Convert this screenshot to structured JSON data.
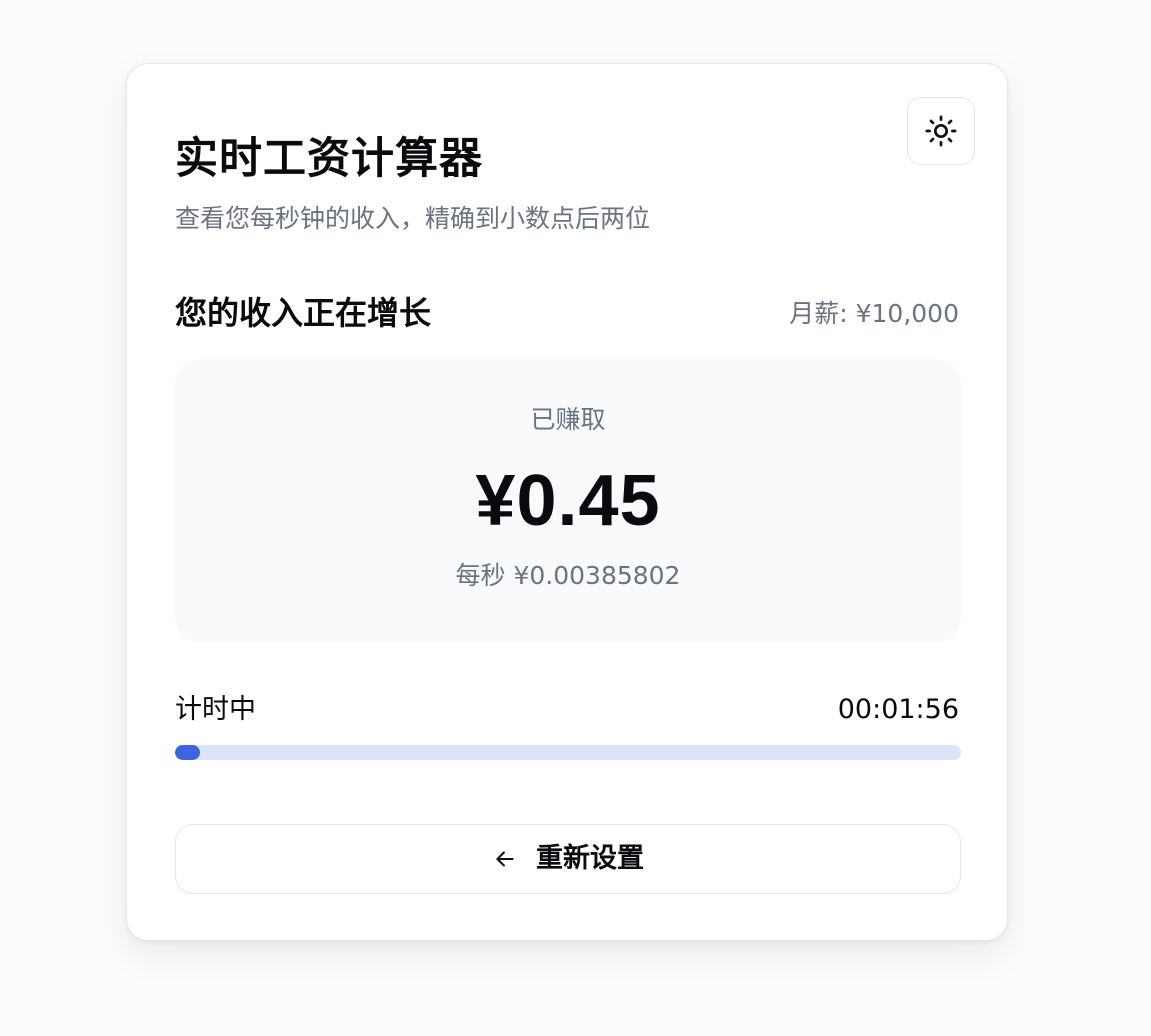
{
  "header": {
    "title": "实时工资计算器",
    "subtitle": "查看您每秒钟的收入，精确到小数点后两位",
    "theme_toggle_icon": "sun-icon"
  },
  "summary": {
    "heading": "您的收入正在增长",
    "monthly_salary": "月薪: ¥10,000"
  },
  "earnings": {
    "label": "已赚取",
    "amount": "¥0.45",
    "per_second": "每秒 ¥0.00385802"
  },
  "timer": {
    "status": "计时中",
    "elapsed": "00:01:56",
    "progress_fraction": 0.032
  },
  "actions": {
    "reset_label": "重新设置",
    "reset_icon": "arrow-left-icon"
  },
  "colors": {
    "accent": "#3d63dd",
    "track": "#dde3fb",
    "muted_text": "#6b7280"
  }
}
